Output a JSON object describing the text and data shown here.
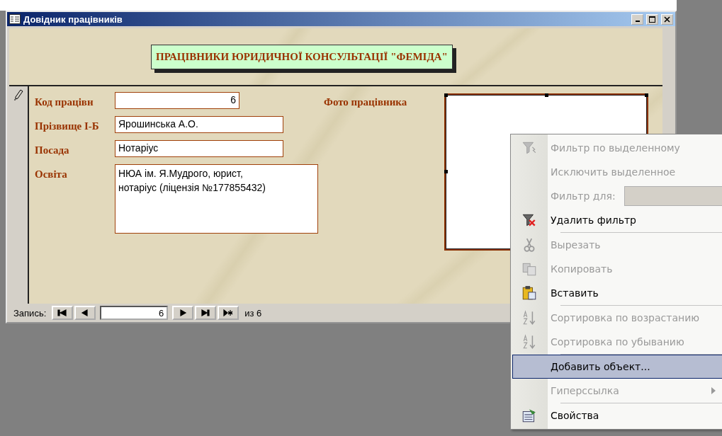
{
  "window": {
    "title": "Довідник працівників"
  },
  "form": {
    "heading": "ПРАЦІВНИКИ ЮРИДИЧНОЇ КОНСУЛЬТАЦІЇ \"ФЕМІДА\"",
    "fields": [
      {
        "label": "Код працівн",
        "value": "6",
        "kind": "number"
      },
      {
        "label": "Прізвище І-Б",
        "value": "Ярошинська А.О.",
        "kind": "text"
      },
      {
        "label": "Посада",
        "value": "Нотаріус",
        "kind": "text"
      },
      {
        "label": "Освіта",
        "value": "НЮА ім. Я.Мудрого, юрист, нотаріус (ліцензія №177855432)",
        "kind": "memo"
      }
    ],
    "photo_label": "Фото працівника"
  },
  "navigation": {
    "label": "Запись:",
    "current": "6",
    "total": "из 6"
  },
  "context_menu": [
    {
      "kind": "item",
      "label": "Фильтр по выделенному",
      "disabled": true,
      "selected": false
    },
    {
      "kind": "item",
      "label": "Исключить выделенное",
      "disabled": true,
      "selected": false
    },
    {
      "kind": "field",
      "label": "Фильтр для:",
      "disabled": true,
      "selected": false
    },
    {
      "kind": "item",
      "label": "Удалить фильтр",
      "disabled": false,
      "selected": false
    },
    {
      "kind": "separator"
    },
    {
      "kind": "item",
      "label": "Вырезать",
      "disabled": true,
      "selected": false
    },
    {
      "kind": "item",
      "label": "Копировать",
      "disabled": true,
      "selected": false
    },
    {
      "kind": "item",
      "label": "Вставить",
      "disabled": false,
      "selected": false
    },
    {
      "kind": "separator"
    },
    {
      "kind": "item",
      "label": "Сортировка по возрастанию",
      "disabled": true,
      "selected": false
    },
    {
      "kind": "item",
      "label": "Сортировка по убыванию",
      "disabled": true,
      "selected": false
    },
    {
      "kind": "separator"
    },
    {
      "kind": "item",
      "label": "Добавить объект...",
      "disabled": false,
      "selected": true
    },
    {
      "kind": "item",
      "label": "Гиперссылка",
      "disabled": true,
      "selected": false,
      "submenu": true
    },
    {
      "kind": "separator"
    },
    {
      "kind": "item",
      "label": "Свойства",
      "disabled": false,
      "selected": false
    }
  ]
}
